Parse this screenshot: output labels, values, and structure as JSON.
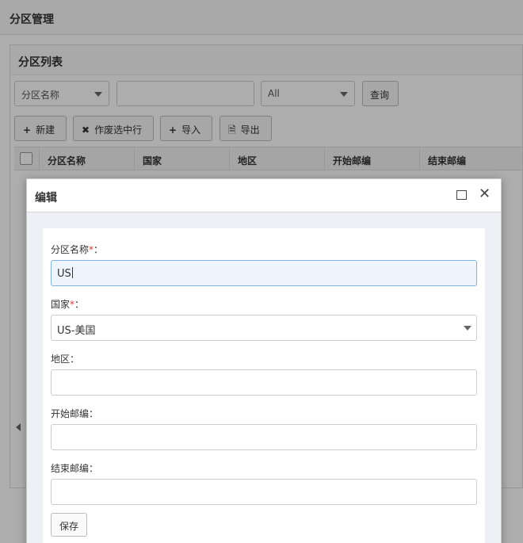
{
  "page": {
    "title": "分区管理",
    "panel_title": "分区列表"
  },
  "search": {
    "field_select": "分区名称",
    "keyword_value": "",
    "scope_select": "All",
    "query_label": "查询"
  },
  "toolbar": {
    "new_label": "新建",
    "new_icon": "+",
    "void_label": "作废选中行",
    "void_icon": "✖",
    "import_label": "导入",
    "import_icon": "+",
    "export_label": "导出",
    "export_icon": "🗎"
  },
  "grid": {
    "columns": [
      "分区名称",
      "国家",
      "地区",
      "开始邮编",
      "结束邮编"
    ]
  },
  "modal": {
    "title": "编辑",
    "maximize_icon": "maximize-icon",
    "close_glyph": "✕",
    "fields": {
      "name": {
        "label": "分区名称",
        "required_mark": "*",
        "colon": "：",
        "value": "US"
      },
      "country": {
        "label": "国家",
        "required_mark": "*",
        "colon": "：",
        "value": "US-美国"
      },
      "region": {
        "label": "地区：",
        "value": ""
      },
      "start_zip": {
        "label": "开始邮编：",
        "value": ""
      },
      "end_zip": {
        "label": "结束邮编：",
        "value": ""
      }
    },
    "save_label": "保存"
  },
  "colors": {
    "required": "#e53935",
    "focus_border": "#7fb3e6",
    "focus_bg": "#eef5fd"
  }
}
